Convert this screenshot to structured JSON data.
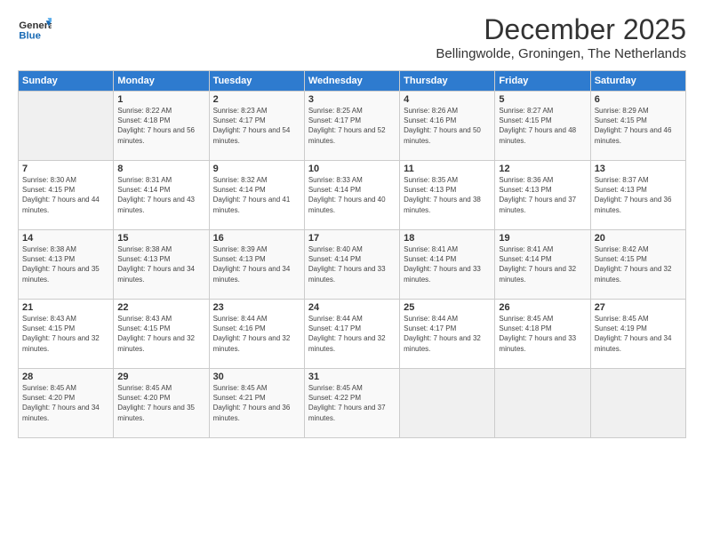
{
  "header": {
    "logo_line1": "General",
    "logo_line2": "Blue",
    "month": "December 2025",
    "location": "Bellingwolde, Groningen, The Netherlands"
  },
  "days_of_week": [
    "Sunday",
    "Monday",
    "Tuesday",
    "Wednesday",
    "Thursday",
    "Friday",
    "Saturday"
  ],
  "weeks": [
    [
      {
        "day": "",
        "empty": true
      },
      {
        "day": "1",
        "sunrise": "8:22 AM",
        "sunset": "4:18 PM",
        "daylight": "7 hours and 56 minutes."
      },
      {
        "day": "2",
        "sunrise": "8:23 AM",
        "sunset": "4:17 PM",
        "daylight": "7 hours and 54 minutes."
      },
      {
        "day": "3",
        "sunrise": "8:25 AM",
        "sunset": "4:17 PM",
        "daylight": "7 hours and 52 minutes."
      },
      {
        "day": "4",
        "sunrise": "8:26 AM",
        "sunset": "4:16 PM",
        "daylight": "7 hours and 50 minutes."
      },
      {
        "day": "5",
        "sunrise": "8:27 AM",
        "sunset": "4:15 PM",
        "daylight": "7 hours and 48 minutes."
      },
      {
        "day": "6",
        "sunrise": "8:29 AM",
        "sunset": "4:15 PM",
        "daylight": "7 hours and 46 minutes."
      }
    ],
    [
      {
        "day": "7",
        "sunrise": "8:30 AM",
        "sunset": "4:15 PM",
        "daylight": "7 hours and 44 minutes."
      },
      {
        "day": "8",
        "sunrise": "8:31 AM",
        "sunset": "4:14 PM",
        "daylight": "7 hours and 43 minutes."
      },
      {
        "day": "9",
        "sunrise": "8:32 AM",
        "sunset": "4:14 PM",
        "daylight": "7 hours and 41 minutes."
      },
      {
        "day": "10",
        "sunrise": "8:33 AM",
        "sunset": "4:14 PM",
        "daylight": "7 hours and 40 minutes."
      },
      {
        "day": "11",
        "sunrise": "8:35 AM",
        "sunset": "4:13 PM",
        "daylight": "7 hours and 38 minutes."
      },
      {
        "day": "12",
        "sunrise": "8:36 AM",
        "sunset": "4:13 PM",
        "daylight": "7 hours and 37 minutes."
      },
      {
        "day": "13",
        "sunrise": "8:37 AM",
        "sunset": "4:13 PM",
        "daylight": "7 hours and 36 minutes."
      }
    ],
    [
      {
        "day": "14",
        "sunrise": "8:38 AM",
        "sunset": "4:13 PM",
        "daylight": "7 hours and 35 minutes."
      },
      {
        "day": "15",
        "sunrise": "8:38 AM",
        "sunset": "4:13 PM",
        "daylight": "7 hours and 34 minutes."
      },
      {
        "day": "16",
        "sunrise": "8:39 AM",
        "sunset": "4:13 PM",
        "daylight": "7 hours and 34 minutes."
      },
      {
        "day": "17",
        "sunrise": "8:40 AM",
        "sunset": "4:14 PM",
        "daylight": "7 hours and 33 minutes."
      },
      {
        "day": "18",
        "sunrise": "8:41 AM",
        "sunset": "4:14 PM",
        "daylight": "7 hours and 33 minutes."
      },
      {
        "day": "19",
        "sunrise": "8:41 AM",
        "sunset": "4:14 PM",
        "daylight": "7 hours and 32 minutes."
      },
      {
        "day": "20",
        "sunrise": "8:42 AM",
        "sunset": "4:15 PM",
        "daylight": "7 hours and 32 minutes."
      }
    ],
    [
      {
        "day": "21",
        "sunrise": "8:43 AM",
        "sunset": "4:15 PM",
        "daylight": "7 hours and 32 minutes."
      },
      {
        "day": "22",
        "sunrise": "8:43 AM",
        "sunset": "4:15 PM",
        "daylight": "7 hours and 32 minutes."
      },
      {
        "day": "23",
        "sunrise": "8:44 AM",
        "sunset": "4:16 PM",
        "daylight": "7 hours and 32 minutes."
      },
      {
        "day": "24",
        "sunrise": "8:44 AM",
        "sunset": "4:17 PM",
        "daylight": "7 hours and 32 minutes."
      },
      {
        "day": "25",
        "sunrise": "8:44 AM",
        "sunset": "4:17 PM",
        "daylight": "7 hours and 32 minutes."
      },
      {
        "day": "26",
        "sunrise": "8:45 AM",
        "sunset": "4:18 PM",
        "daylight": "7 hours and 33 minutes."
      },
      {
        "day": "27",
        "sunrise": "8:45 AM",
        "sunset": "4:19 PM",
        "daylight": "7 hours and 34 minutes."
      }
    ],
    [
      {
        "day": "28",
        "sunrise": "8:45 AM",
        "sunset": "4:20 PM",
        "daylight": "7 hours and 34 minutes."
      },
      {
        "day": "29",
        "sunrise": "8:45 AM",
        "sunset": "4:20 PM",
        "daylight": "7 hours and 35 minutes."
      },
      {
        "day": "30",
        "sunrise": "8:45 AM",
        "sunset": "4:21 PM",
        "daylight": "7 hours and 36 minutes."
      },
      {
        "day": "31",
        "sunrise": "8:45 AM",
        "sunset": "4:22 PM",
        "daylight": "7 hours and 37 minutes."
      },
      {
        "day": "",
        "empty": true
      },
      {
        "day": "",
        "empty": true
      },
      {
        "day": "",
        "empty": true
      }
    ]
  ]
}
